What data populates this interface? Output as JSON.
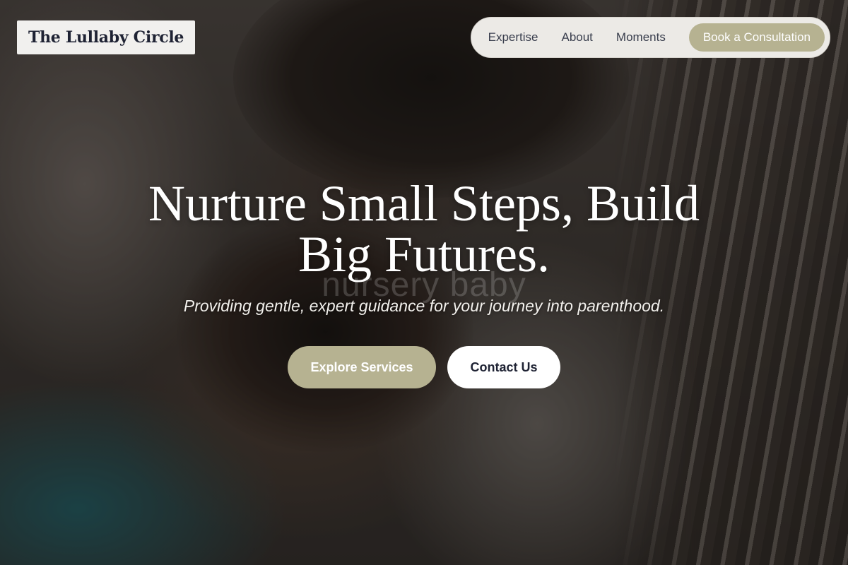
{
  "brand": {
    "name": "The Lullaby Circle"
  },
  "nav": {
    "links": [
      "Expertise",
      "About",
      "Moments"
    ],
    "cta_label": "Book a Consultation"
  },
  "hero": {
    "headline_line1": "Nurture Small Steps, Build",
    "headline_line2": "Big Futures.",
    "background_ghost_text": "nursery baby",
    "subheadline": "Providing gentle, expert guidance for your journey into parenthood.",
    "primary_button_label": "Explore Services",
    "secondary_button_label": "Contact Us"
  },
  "colors": {
    "accent": "#b6b291",
    "nav_background": "#eceae6",
    "logo_background": "#f1f0ee",
    "text_dark": "#1e2233",
    "hero_text": "#ffffff"
  }
}
